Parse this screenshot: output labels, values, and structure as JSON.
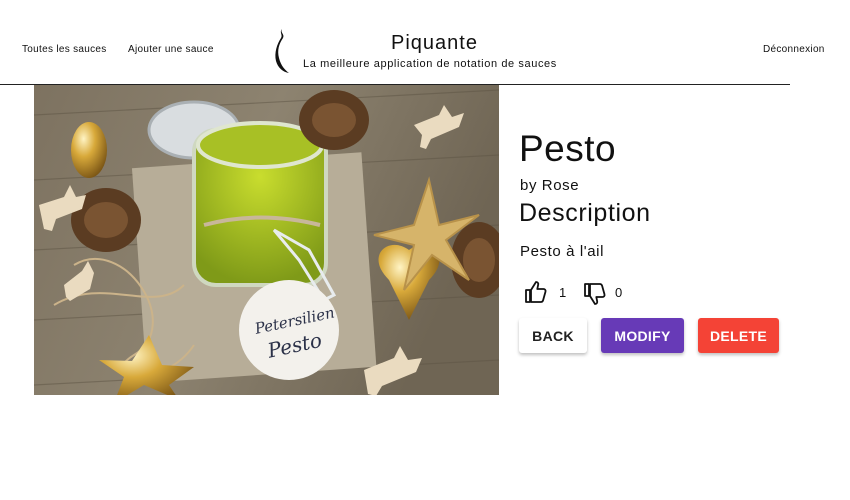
{
  "nav": {
    "all_sauces": "Toutes les sauces",
    "add_sauce": "Ajouter une sauce",
    "logout": "Déconnexion"
  },
  "brand": {
    "title": "Piquante",
    "subtitle": "La meilleure application de notation de sauces",
    "logo_icon": "chili-pepper-icon"
  },
  "sauce": {
    "name": "Pesto",
    "by": "by Rose",
    "description_heading": "Description",
    "description": "Pesto à l'ail",
    "likes": "1",
    "dislikes": "0",
    "label_text": [
      "Petersilien",
      "Pesto"
    ]
  },
  "buttons": {
    "back": "BACK",
    "modify": "MODIFY",
    "delete": "DELETE"
  },
  "colors": {
    "modify": "#673ab7",
    "delete": "#f44336"
  }
}
